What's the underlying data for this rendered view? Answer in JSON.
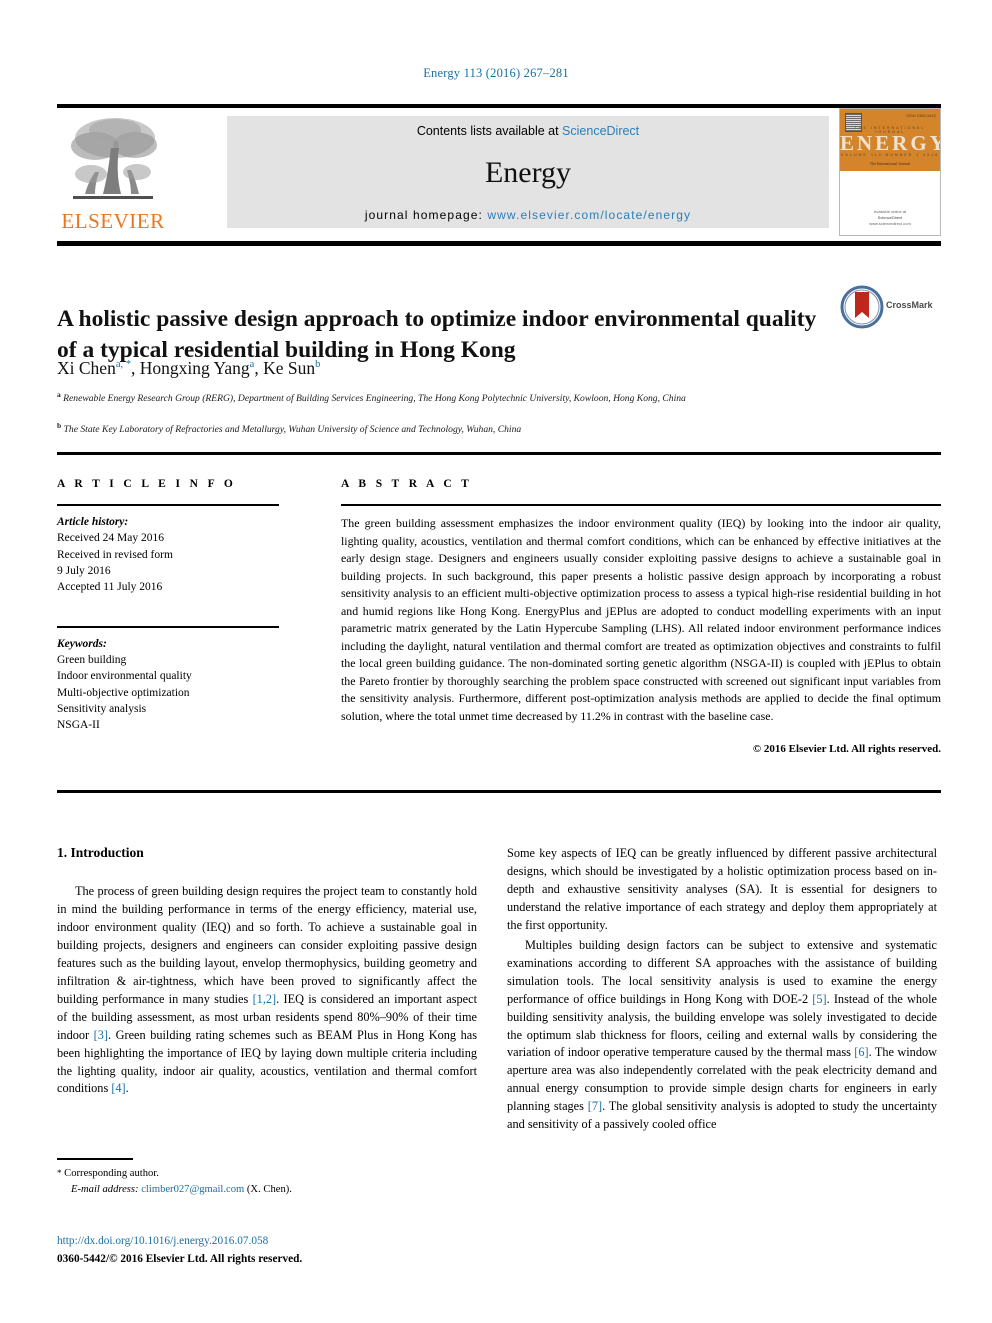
{
  "running_head": "Energy 113 (2016) 267–281",
  "masthead": {
    "contents_prefix": "Contents lists available at ",
    "contents_link": "ScienceDirect",
    "journal_name": "Energy",
    "homepage_prefix": "journal homepage: ",
    "homepage_url": "www.elsevier.com/locate/energy",
    "publisher_word": "ELSEVIER",
    "publisher_icon": "elsevier-tree-logo",
    "cover": {
      "title_word": "ENERGY",
      "top_right_note": "ISSN 0360-5442",
      "tiny_row_1": "THE INTERNATIONAL JOURNAL",
      "tiny_row_2": "VOLUME   113   NUMBER   1   2016",
      "subtitle": "The International Journal",
      "footer_line1": "Available online at",
      "footer_line2": "ScienceDirect",
      "footer_line3": "www.sciencedirect.com"
    }
  },
  "article": {
    "title": "A holistic passive design approach to optimize indoor environmental quality of a typical residential building in Hong Kong",
    "crossmark_label": "CrossMark",
    "crossmark_icon": "crossmark-logo",
    "authors_plain": "Xi Chen a, *, Hongxing Yang a, Ke Sun b",
    "authors": [
      {
        "name": "Xi Chen",
        "marks": "a, *"
      },
      {
        "name": "Hongxing Yang",
        "marks": "a"
      },
      {
        "name": "Ke Sun",
        "marks": "b"
      }
    ],
    "affiliations": [
      {
        "mark": "a",
        "text": "Renewable Energy Research Group (RERG), Department of Building Services Engineering, The Hong Kong Polytechnic University, Kowloon, Hong Kong, China"
      },
      {
        "mark": "b",
        "text": "The State Key Laboratory of Refractories and Metallurgy, Wuhan University of Science and Technology, Wuhan, China"
      }
    ]
  },
  "article_info": {
    "heading": "A R T I C L E   I N F O",
    "history_label": "Article history:",
    "history_lines": [
      "Received 24 May 2016",
      "Received in revised form",
      "9 July 2016",
      "Accepted 11 July 2016"
    ],
    "keywords_label": "Keywords:",
    "keywords": [
      "Green building",
      "Indoor environmental quality",
      "Multi-objective optimization",
      "Sensitivity analysis",
      "NSGA-II"
    ]
  },
  "abstract": {
    "heading": "A B S T R A C T",
    "text": "The green building assessment emphasizes the indoor environment quality (IEQ) by looking into the indoor air quality, lighting quality, acoustics, ventilation and thermal comfort conditions, which can be enhanced by effective initiatives at the early design stage. Designers and engineers usually consider exploiting passive designs to achieve a sustainable goal in building projects. In such background, this paper presents a holistic passive design approach by incorporating a robust sensitivity analysis to an efficient multi-objective optimization process to assess a typical high-rise residential building in hot and humid regions like Hong Kong. EnergyPlus and jEPlus are adopted to conduct modelling experiments with an input parametric matrix generated by the Latin Hypercube Sampling (LHS). All related indoor environment performance indices including the daylight, natural ventilation and thermal comfort are treated as optimization objectives and constraints to fulfil the local green building guidance. The non-dominated sorting genetic algorithm (NSGA-II) is coupled with jEPlus to obtain the Pareto frontier by thoroughly searching the problem space constructed with screened out significant input variables from the sensitivity analysis. Furthermore, different post-optimization analysis methods are applied to decide the final optimum solution, where the total unmet time decreased by 11.2% in contrast with the baseline case.",
    "copyright": "© 2016 Elsevier Ltd. All rights reserved."
  },
  "body": {
    "section_heading": "1. Introduction",
    "left_paragraph_1_a": "The process of green building design requires the project team to constantly hold in mind the building performance in terms of the energy efficiency, material use, indoor environment quality (IEQ) and so forth. To achieve a sustainable goal in building projects, designers and engineers can consider exploiting passive design features such as the building layout, envelop thermophysics, building geometry and infiltration & air-tightness, which have been proved to significantly affect the building performance in many studies ",
    "ref_12": "[1,2]",
    "left_paragraph_1_b": ". IEQ is considered an important aspect of the building assessment, as most urban residents spend 80%–90% of their time indoor ",
    "ref_3": "[3]",
    "left_paragraph_1_c": ". Green building rating schemes such as BEAM Plus in Hong Kong has been highlighting the importance of IEQ by laying down multiple criteria including the lighting quality, indoor air quality, acoustics, ventilation and thermal comfort conditions ",
    "ref_4": "[4]",
    "left_paragraph_1_d": ".",
    "right_paragraph_1": "Some key aspects of IEQ can be greatly influenced by different passive architectural designs, which should be investigated by a holistic optimization process based on in-depth and exhaustive sensitivity analyses (SA). It is essential for designers to understand the relative importance of each strategy and deploy them appropriately at the first opportunity.",
    "right_paragraph_2_a": "Multiples building design factors can be subject to extensive and systematic examinations according to different SA approaches with the assistance of building simulation tools. The local sensitivity analysis is used to examine the energy performance of office buildings in Hong Kong with DOE-2 ",
    "ref_5": "[5]",
    "right_paragraph_2_b": ". Instead of the whole building sensitivity analysis, the building envelope was solely investigated to decide the optimum slab thickness for floors, ceiling and external walls by considering the variation of indoor operative temperature caused by the thermal mass ",
    "ref_6": "[6]",
    "right_paragraph_2_c": ". The window aperture area was also independently correlated with the peak electricity demand and annual energy consumption to provide simple design charts for engineers in early planning stages ",
    "ref_7": "[7]",
    "right_paragraph_2_d": ". The global sensitivity analysis is adopted to study the uncertainty and sensitivity of a passively cooled office"
  },
  "footnotes": {
    "corresponding_marker": "*",
    "corresponding_text": "Corresponding author.",
    "email_label": "E-mail address:",
    "email": "climber027@gmail.com",
    "email_owner": "(X. Chen).",
    "doi": "http://dx.doi.org/10.1016/j.energy.2016.07.058",
    "issn_line": "0360-5442/© 2016 Elsevier Ltd. All rights reserved."
  },
  "colors": {
    "link": "#1a6fa3",
    "elsevier_orange": "#e87722",
    "cover_orange": "#d4842a",
    "band_gray": "#e3e3e3"
  }
}
